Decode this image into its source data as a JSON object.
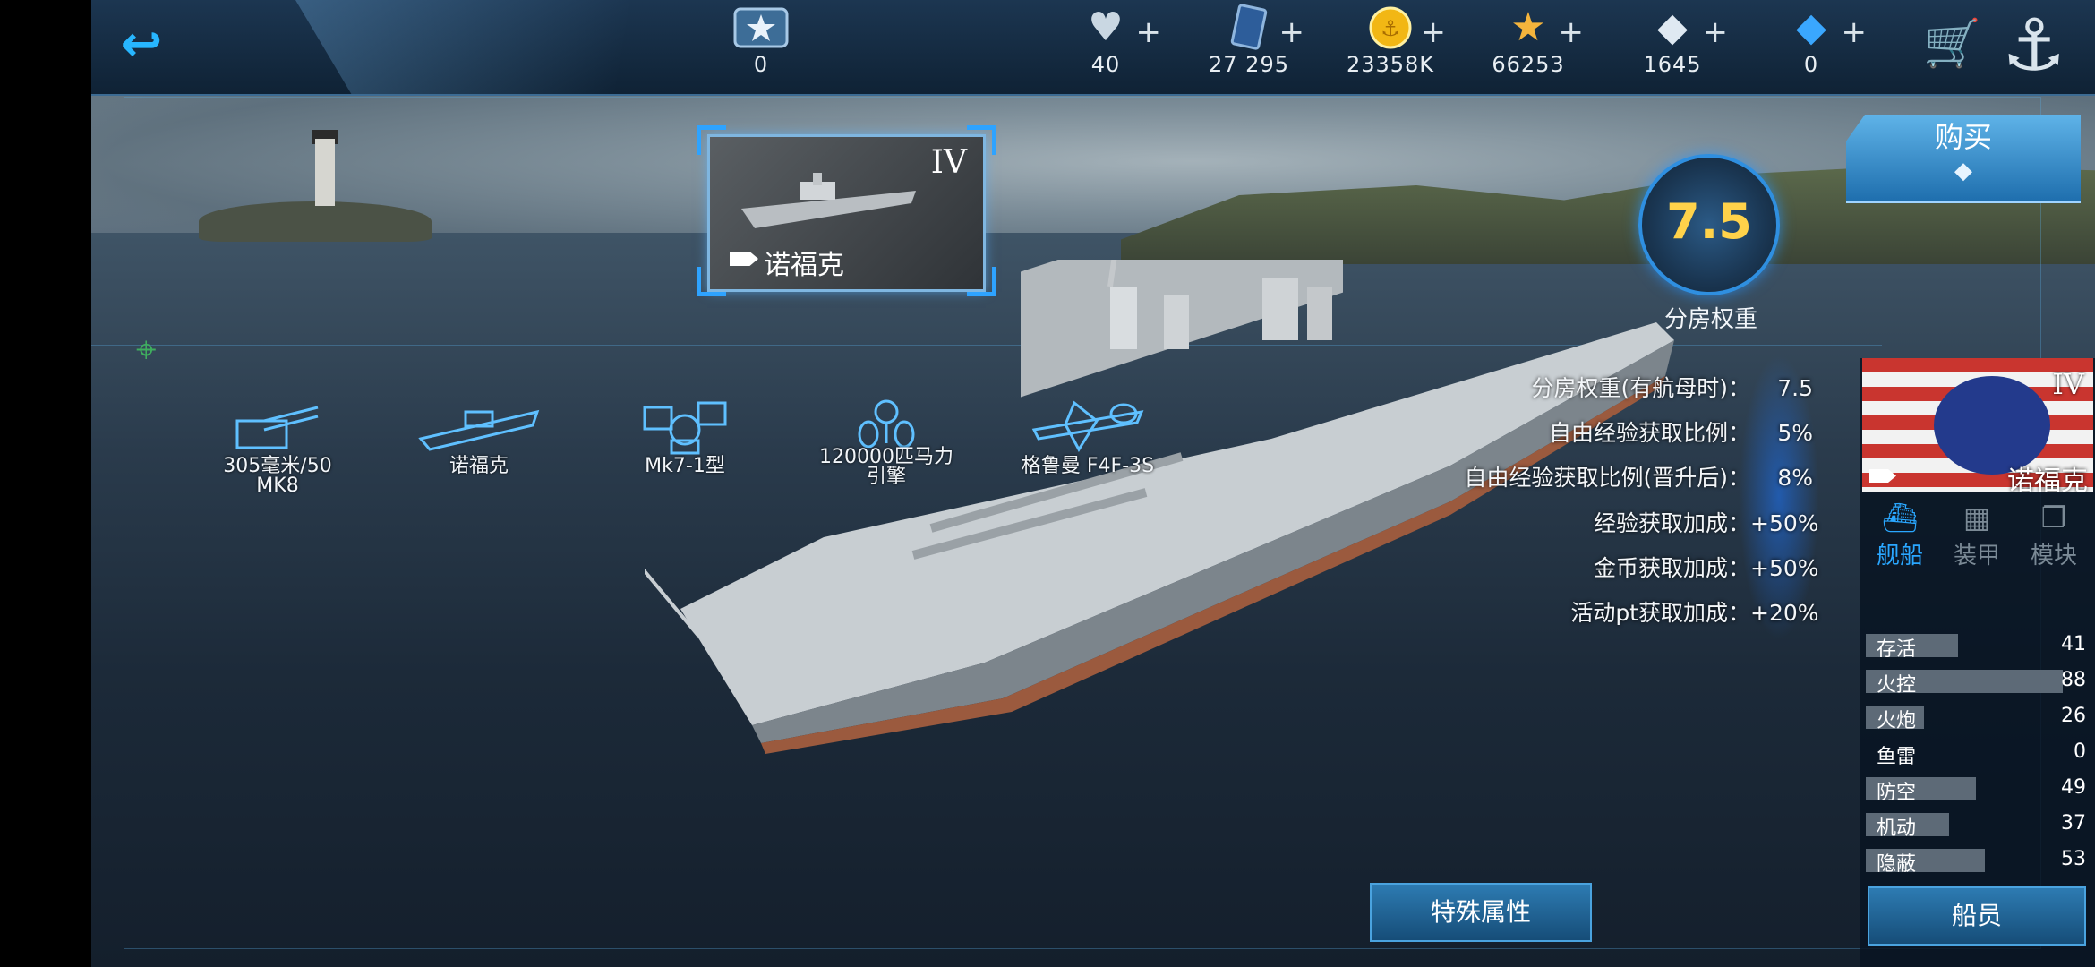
{
  "topbar": {
    "rank_value": "0",
    "resources": [
      {
        "icon": "heart-icon",
        "value": "40"
      },
      {
        "icon": "card-icon",
        "value": "27 295"
      },
      {
        "icon": "gold-coin-icon",
        "value": "23358K"
      },
      {
        "icon": "star-icon",
        "value": "66253"
      },
      {
        "icon": "diamond-icon",
        "value": "1645"
      },
      {
        "icon": "crystal-icon",
        "value": "0"
      }
    ],
    "plus": "+"
  },
  "selected_ship": {
    "name": "诺福克",
    "tier": "IV"
  },
  "equipment": [
    {
      "label": "305毫米/50 MK8",
      "icon": "turret-icon"
    },
    {
      "label": "诺福克",
      "icon": "hull-icon"
    },
    {
      "label": "Mk7-1型",
      "icon": "radar-icon"
    },
    {
      "label": "120000匹马力 引擎",
      "icon": "engine-icon"
    },
    {
      "label": "格鲁曼 F4F-3S",
      "icon": "plane-icon"
    }
  ],
  "weight": {
    "value": "7.5",
    "label": "分房权重"
  },
  "stats": [
    {
      "label": "分房权重(有航母时)：",
      "value": "7.5"
    },
    {
      "label": "自由经验获取比例：",
      "value": "5%"
    },
    {
      "label": "自由经验获取比例(晋升后)：",
      "value": "8%"
    },
    {
      "label": "经验获取加成：",
      "value": "+50%"
    },
    {
      "label": "金币获取加成：",
      "value": "+50%"
    },
    {
      "label": "活动pt获取加成：",
      "value": "+20%"
    }
  ],
  "buy": {
    "label": "购买"
  },
  "panel": {
    "tier": "IV",
    "name": "诺福克",
    "tabs": [
      {
        "label": "舰船",
        "icon": "ship-tab-icon",
        "active": true
      },
      {
        "label": "装甲",
        "icon": "armor-tab-icon",
        "active": false
      },
      {
        "label": "模块",
        "icon": "module-tab-icon",
        "active": false
      }
    ],
    "attributes": [
      {
        "name": "存活",
        "value": "41"
      },
      {
        "name": "火控",
        "value": "88"
      },
      {
        "name": "火炮",
        "value": "26"
      },
      {
        "name": "鱼雷",
        "value": "0"
      },
      {
        "name": "防空",
        "value": "49"
      },
      {
        "name": "机动",
        "value": "37"
      },
      {
        "name": "隐蔽",
        "value": "53"
      }
    ],
    "crew_button": "船员"
  },
  "special_button": "特殊属性"
}
